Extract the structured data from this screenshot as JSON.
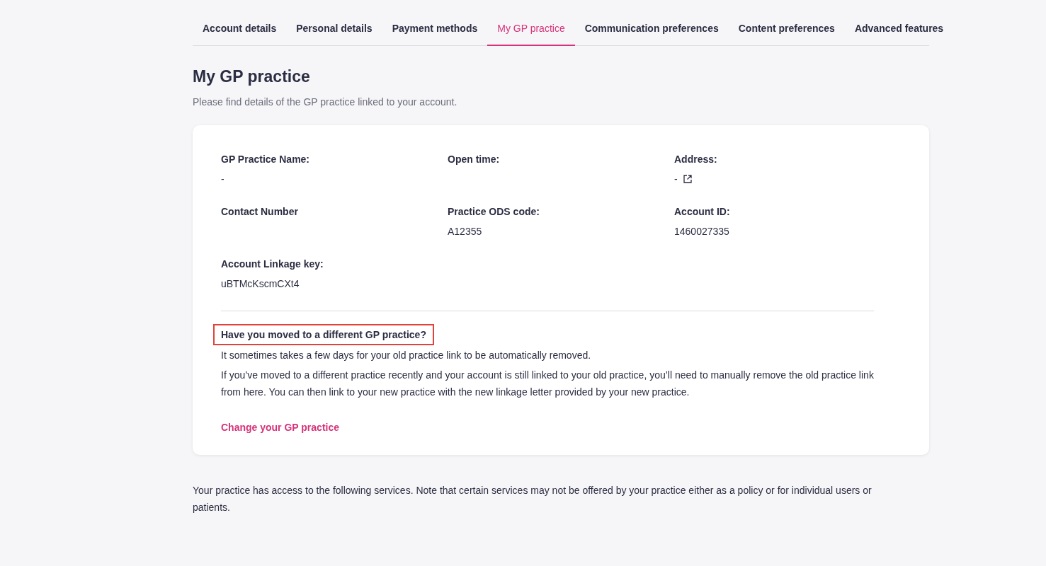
{
  "tabs": [
    {
      "label": "Account details",
      "selected": false
    },
    {
      "label": "Personal details",
      "selected": false
    },
    {
      "label": "Payment methods",
      "selected": false
    },
    {
      "label": "My GP practice",
      "selected": true
    },
    {
      "label": "Communication preferences",
      "selected": false
    },
    {
      "label": "Content preferences",
      "selected": false
    },
    {
      "label": "Advanced features",
      "selected": false
    }
  ],
  "page": {
    "title": "My GP practice",
    "subtitle": "Please find details of the GP practice linked to your account."
  },
  "fields": [
    {
      "label": "GP Practice Name:",
      "value": "-"
    },
    {
      "label": "Open time:"
    },
    {
      "label": "Address:",
      "value": "-",
      "external_link": true
    },
    {
      "label": "Contact Number"
    },
    {
      "label": "Practice ODS code:",
      "value": "A12355"
    },
    {
      "label": "Account ID:",
      "value": "1460027335"
    },
    {
      "label": "Account Linkage key:",
      "value": "uBTMcKscmCXt4"
    }
  ],
  "moved": {
    "heading": "Have you moved to a different GP practice?",
    "highlighted": true,
    "paragraphs": [
      "It sometimes takes a few days for your old practice link to be automatically removed.",
      "If you’ve moved to a different practice recently and your account is still linked to your old practice, you’ll need to manually remove the old practice link from here. You can then link to your new practice with the new linkage letter provided by your new practice."
    ],
    "link": "Change your GP practice"
  },
  "services_note": "Your practice has access to the following services. Note that certain services may not be offered by your practice either as a policy or for individual users or patients."
}
